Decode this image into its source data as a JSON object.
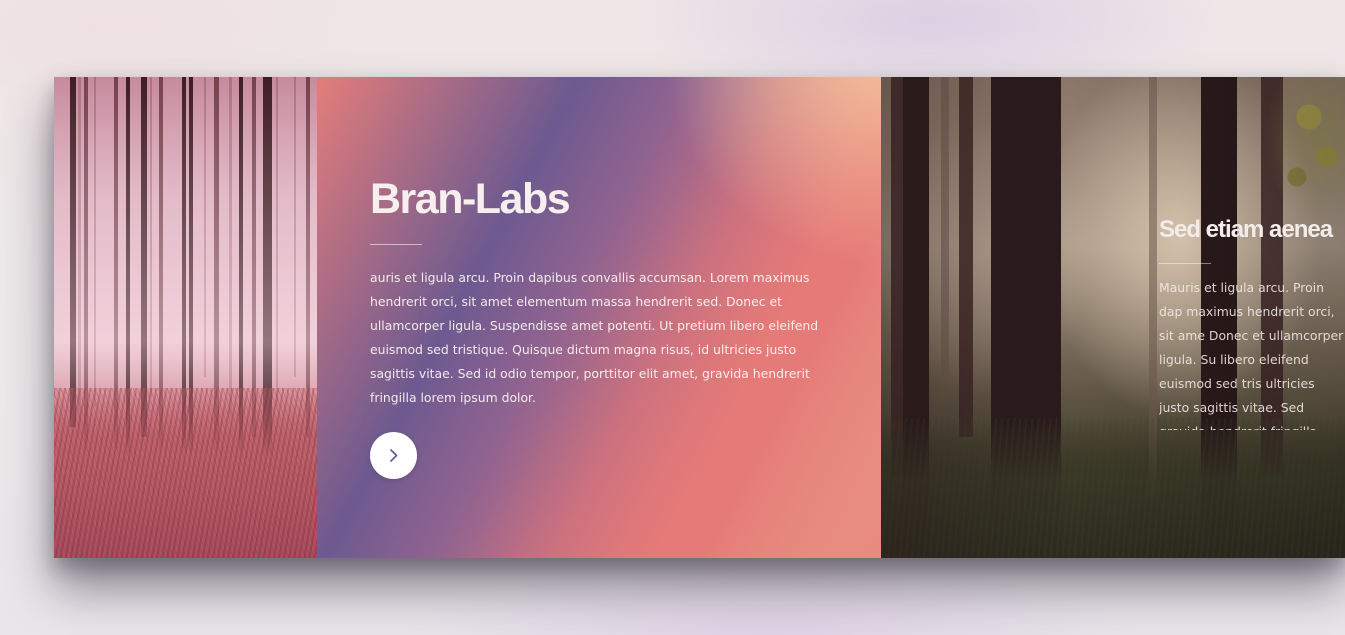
{
  "slides": [
    {
      "title": "Bran-Labs",
      "body": "auris et ligula arcu. Proin dapibus convallis accumsan. Lorem maximus hendrerit orci, sit amet elementum massa hendrerit sed. Donec et ullamcorper ligula. Suspendisse amet potenti. Ut pretium libero eleifend euismod sed tristique. Quisque dictum magna risus, id ultricies justo sagittis vitae. Sed id odio tempor, porttitor elit amet, gravida hendrerit fringilla lorem ipsum dolor.",
      "button_icon": "chevron-right-icon"
    },
    {
      "title": "Sed etiam aenea",
      "body": "Mauris et ligula arcu. Proin dap maximus hendrerit orci, sit ame Donec et ullamcorper ligula. Su libero eleifend euismod sed tris ultricies justo sagittis vitae. Sed gravida hendrerit fringilla lorem"
    }
  ],
  "colors": {
    "panel_gradient_start": "#fce1ac",
    "panel_gradient_mid": "#e57a77",
    "panel_gradient_end": "#6d5a90",
    "button_bg": "#ffffff",
    "button_icon": "#6d5a90"
  }
}
